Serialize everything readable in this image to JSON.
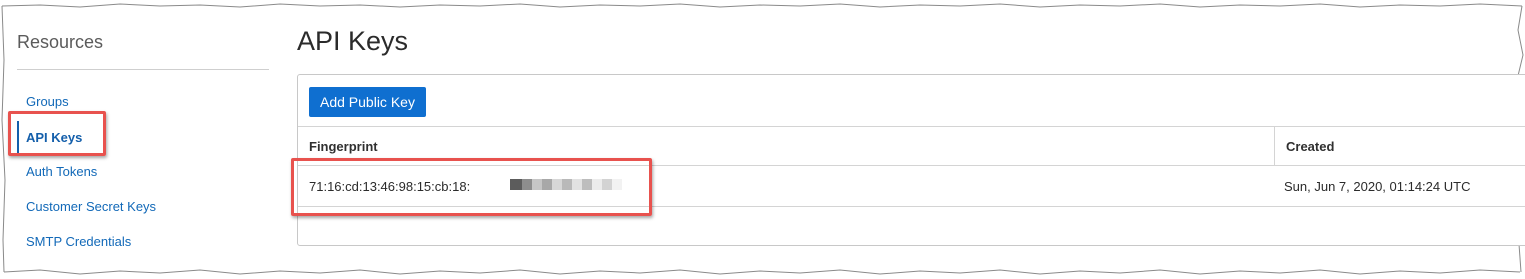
{
  "sidebar": {
    "title": "Resources",
    "items": [
      {
        "label": "Groups",
        "active": false
      },
      {
        "label": "API Keys",
        "active": true
      },
      {
        "label": "Auth Tokens",
        "active": false
      },
      {
        "label": "Customer Secret Keys",
        "active": false
      },
      {
        "label": "SMTP Credentials",
        "active": false
      }
    ]
  },
  "main": {
    "title": "API Keys",
    "add_button_label": "Add Public Key",
    "table": {
      "columns": [
        "Fingerprint",
        "Created"
      ],
      "rows": [
        {
          "fingerprint": "71:16:cd:13:46:98:15:cb:18:",
          "created": "Sun, Jun 7, 2020, 01:14:24 UTC"
        }
      ]
    }
  },
  "colors": {
    "accent": "#0f6fd0",
    "link": "#1269b8",
    "highlight": "#e8524e"
  }
}
